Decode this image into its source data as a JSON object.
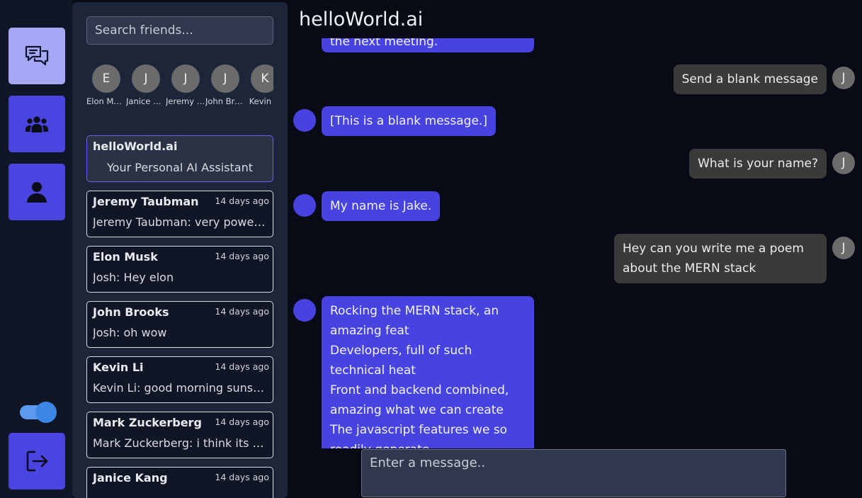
{
  "app": {
    "title": "helloWorld.ai"
  },
  "search": {
    "placeholder": "Search friends..."
  },
  "friends": [
    {
      "initial": "E",
      "name": "Elon Musk"
    },
    {
      "initial": "J",
      "name": "Janice Kang"
    },
    {
      "initial": "J",
      "name": "Jeremy Taubman"
    },
    {
      "initial": "J",
      "name": "John Brooks"
    },
    {
      "initial": "K",
      "name": "Kevin Li"
    }
  ],
  "conversations": [
    {
      "name": "helloWorld.ai",
      "time": "",
      "preview": "Your Personal AI Assistant"
    },
    {
      "name": "Jeremy Taubman",
      "time": "14 days ago",
      "preview": "Jeremy Taubman: very powerful"
    },
    {
      "name": "Elon Musk",
      "time": "14 days ago",
      "preview": "Josh: Hey elon"
    },
    {
      "name": "John Brooks",
      "time": "14 days ago",
      "preview": "Josh: oh wow"
    },
    {
      "name": "Kevin Li",
      "time": "14 days ago",
      "preview": "Kevin Li: good morning sunshine"
    },
    {
      "name": "Mark Zuckerberg",
      "time": "14 days ago",
      "preview": "Mark Zuckerberg: i think its very"
    },
    {
      "name": "Janice Kang",
      "time": "14 days ago",
      "preview": ""
    }
  ],
  "messages": [
    {
      "from": "bot",
      "text": "the next meeting."
    },
    {
      "from": "user",
      "avatar": "J",
      "text": "Send a blank message"
    },
    {
      "from": "bot",
      "text": "[This is a blank message.]"
    },
    {
      "from": "user",
      "avatar": "J",
      "text": "What is your name?"
    },
    {
      "from": "bot",
      "text": "My name is Jake."
    },
    {
      "from": "user",
      "avatar": "J",
      "text": "Hey can you write me a poem about the MERN stack"
    },
    {
      "from": "bot",
      "text": "Rocking the MERN stack, an amazing feat\nDevelopers, full of such technical heat\nFront and backend combined, amazing what we can create\nThe javascript features we so readily generate"
    }
  ],
  "composer": {
    "placeholder": "Enter a message.."
  },
  "colors": {
    "accent": "#4743e0",
    "rail_active": "#a7a8f5",
    "toggle": "#3c86e8",
    "background": "#080a16"
  }
}
